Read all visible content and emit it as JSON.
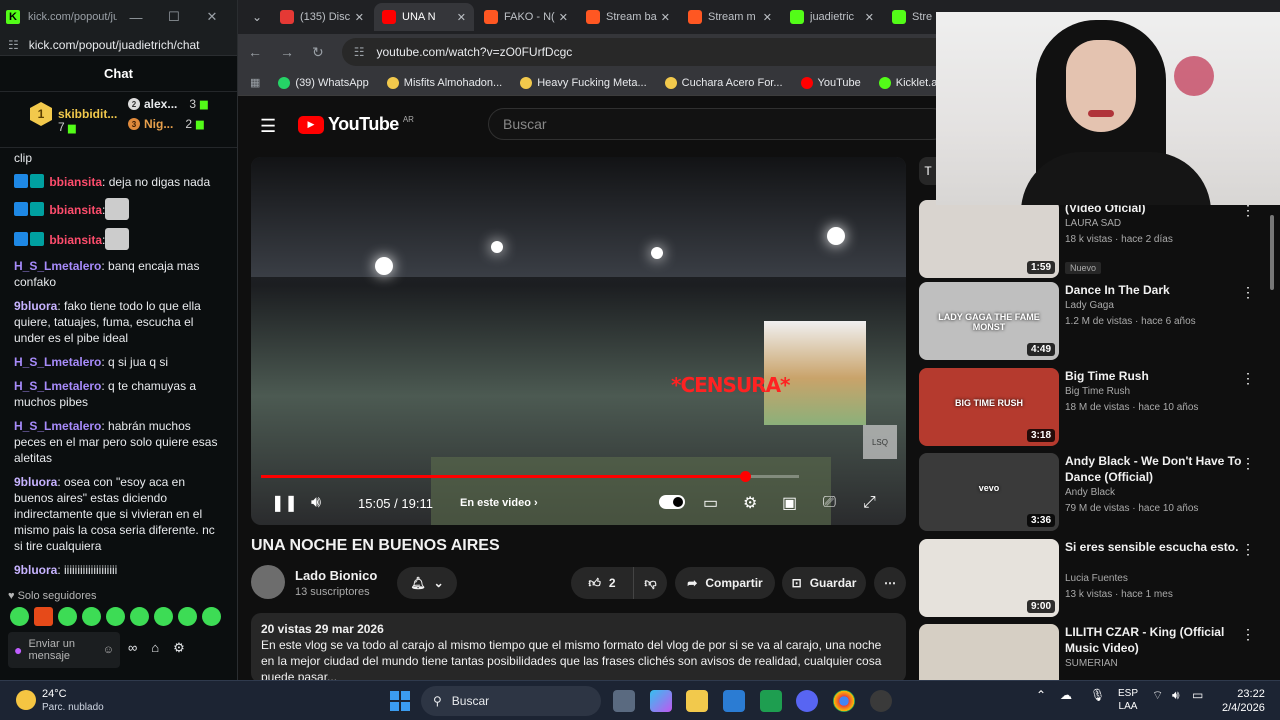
{
  "kick": {
    "window_title": "kick.com/popout/jua...",
    "url": "kick.com/popout/juadietrich/chat",
    "header": "Chat",
    "leaderboard": {
      "first": {
        "rank": "1",
        "name": "skibbidit...",
        "count": "7"
      },
      "second": {
        "name": "alex...",
        "count": "3"
      },
      "third": {
        "rank": "3",
        "name": "Nig...",
        "count": "2"
      }
    },
    "messages": [
      {
        "user": "",
        "text": "clip",
        "color": "#e8eaed"
      },
      {
        "user": "bbiansita",
        "text": ": deja no digas nada",
        "color": "#ff4d6d",
        "badges": true
      },
      {
        "user": "bbiansita",
        "text": ":",
        "color": "#ff4d6d",
        "badges": true,
        "cat": true
      },
      {
        "user": "bbiansita",
        "text": ":",
        "color": "#ff4d6d",
        "badges": true,
        "cat": true
      },
      {
        "user": "H_S_Lmetalero",
        "text": ": banq encaja mas confako",
        "color": "#a78bfa"
      },
      {
        "user": "9bluora",
        "text": ": fako tiene todo lo que ella quiere, tatuajes, fuma, escucha el under es el pibe ideal",
        "color": "#c7b3ff"
      },
      {
        "user": "H_S_Lmetalero",
        "text": ": q si jua q si",
        "color": "#a78bfa"
      },
      {
        "user": "H_S_Lmetalero",
        "text": ": q te chamuyas a muchos pibes",
        "color": "#a78bfa"
      },
      {
        "user": "H_S_Lmetalero",
        "text": ": habrán muchos peces en el mar pero solo quiere esas aletitas",
        "color": "#a78bfa"
      },
      {
        "user": "9bluora",
        "text": ": osea con \"esoy aca en buenos aires\" estas diciendo indirectamente que si vivieran en el mismo pais la cosa seria diferente. nc si tire cualquiera",
        "color": "#c7b3ff"
      },
      {
        "user": "9bluora",
        "text": ": iiiiiiiiiiiiiiiiiiii",
        "color": "#c7b3ff"
      }
    ],
    "followers_only": "Solo seguidores",
    "input_placeholder": "Enviar un mensaje"
  },
  "browser": {
    "tabs": [
      {
        "label": "(135) Disc",
        "color": "#e53935"
      },
      {
        "label": "UNA N",
        "color": "#ff0000",
        "active": true
      },
      {
        "label": "FAKO - N(",
        "color": "#ff5722"
      },
      {
        "label": "Stream ba",
        "color": "#ff5722"
      },
      {
        "label": "Stream m",
        "color": "#ff5722"
      },
      {
        "label": "juadietric",
        "color": "#53fc18"
      },
      {
        "label": "Stre",
        "color": "#53fc18"
      }
    ],
    "url": "youtube.com/watch?v=zO0FUrfDcgc",
    "bookmarks": [
      "(39) WhatsApp",
      "Misfits Almohadon...",
      "Heavy Fucking Meta...",
      "Cuchara Acero For...",
      "YouTube",
      "Kicklet.app - Kick"
    ]
  },
  "youtube": {
    "logo": "YouTube",
    "country": "AR",
    "search_placeholder": "Buscar",
    "player": {
      "overlay_text": "*CENSURA*",
      "watermark": "LSQ",
      "progress": 0.9,
      "time": "15:05 / 19:11",
      "in_video": "En este video"
    },
    "video_title": "UNA NOCHE EN BUENOS AIRES",
    "channel": {
      "name": "Lado Bionico",
      "subs": "13 suscriptores"
    },
    "likes": "2",
    "share": "Compartir",
    "save": "Guardar",
    "description": {
      "meta": "20 vistas  29 mar 2026",
      "text": "En este vlog se va todo al carajo al mismo tiempo que el mismo formato del vlog de por si se va al carajo, una noche en la mejor ciudad del mundo tiene tantas posibilidades que las frases clichés son avisos de realidad, cualquier cosa puede pasar..."
    },
    "chip": "T",
    "recommendations": [
      {
        "title": "(Video Oficial)",
        "channel": "LAURA SAD",
        "meta": "18 k vistas · hace 2 días",
        "duration": "1:59",
        "badge": "Nuevo",
        "thumb": "#d9d4cf"
      },
      {
        "title": "Dance In The Dark",
        "channel": "Lady Gaga",
        "meta": "1.2 M de vistas · hace 6 años",
        "duration": "4:49",
        "thumb": "#bfbfbf",
        "thumb_text": "LADY GAGA THE FAME MONST"
      },
      {
        "title": "Big Time Rush",
        "channel": "Big Time Rush",
        "meta": "18 M de vistas · hace 10 años",
        "duration": "3:18",
        "thumb": "#b53a2e",
        "thumb_text": "BIG TIME RUSH"
      },
      {
        "title": "Andy Black - We Don't Have To Dance (Official)",
        "channel": "Andy Black",
        "meta": "79 M de vistas · hace 10 años",
        "duration": "3:36",
        "thumb": "#3a3a3a",
        "thumb_text": "vevo"
      },
      {
        "title": "Si eres sensible escucha esto.",
        "channel": "Lucia Fuentes",
        "meta": "13 k vistas · hace 1 mes",
        "duration": "9:00",
        "thumb": "#e6e2dc"
      },
      {
        "title": "LILITH CZAR - King (Official Music Video)",
        "channel": "SUMERIAN",
        "meta": "",
        "duration": "",
        "thumb": "#d6cfc4"
      }
    ]
  },
  "taskbar": {
    "temp": "24°C",
    "weather": "Parc. nublado",
    "search": "Buscar",
    "lang1": "ESP",
    "lang2": "LAA",
    "time": "23:22",
    "date": "2/4/2026"
  }
}
